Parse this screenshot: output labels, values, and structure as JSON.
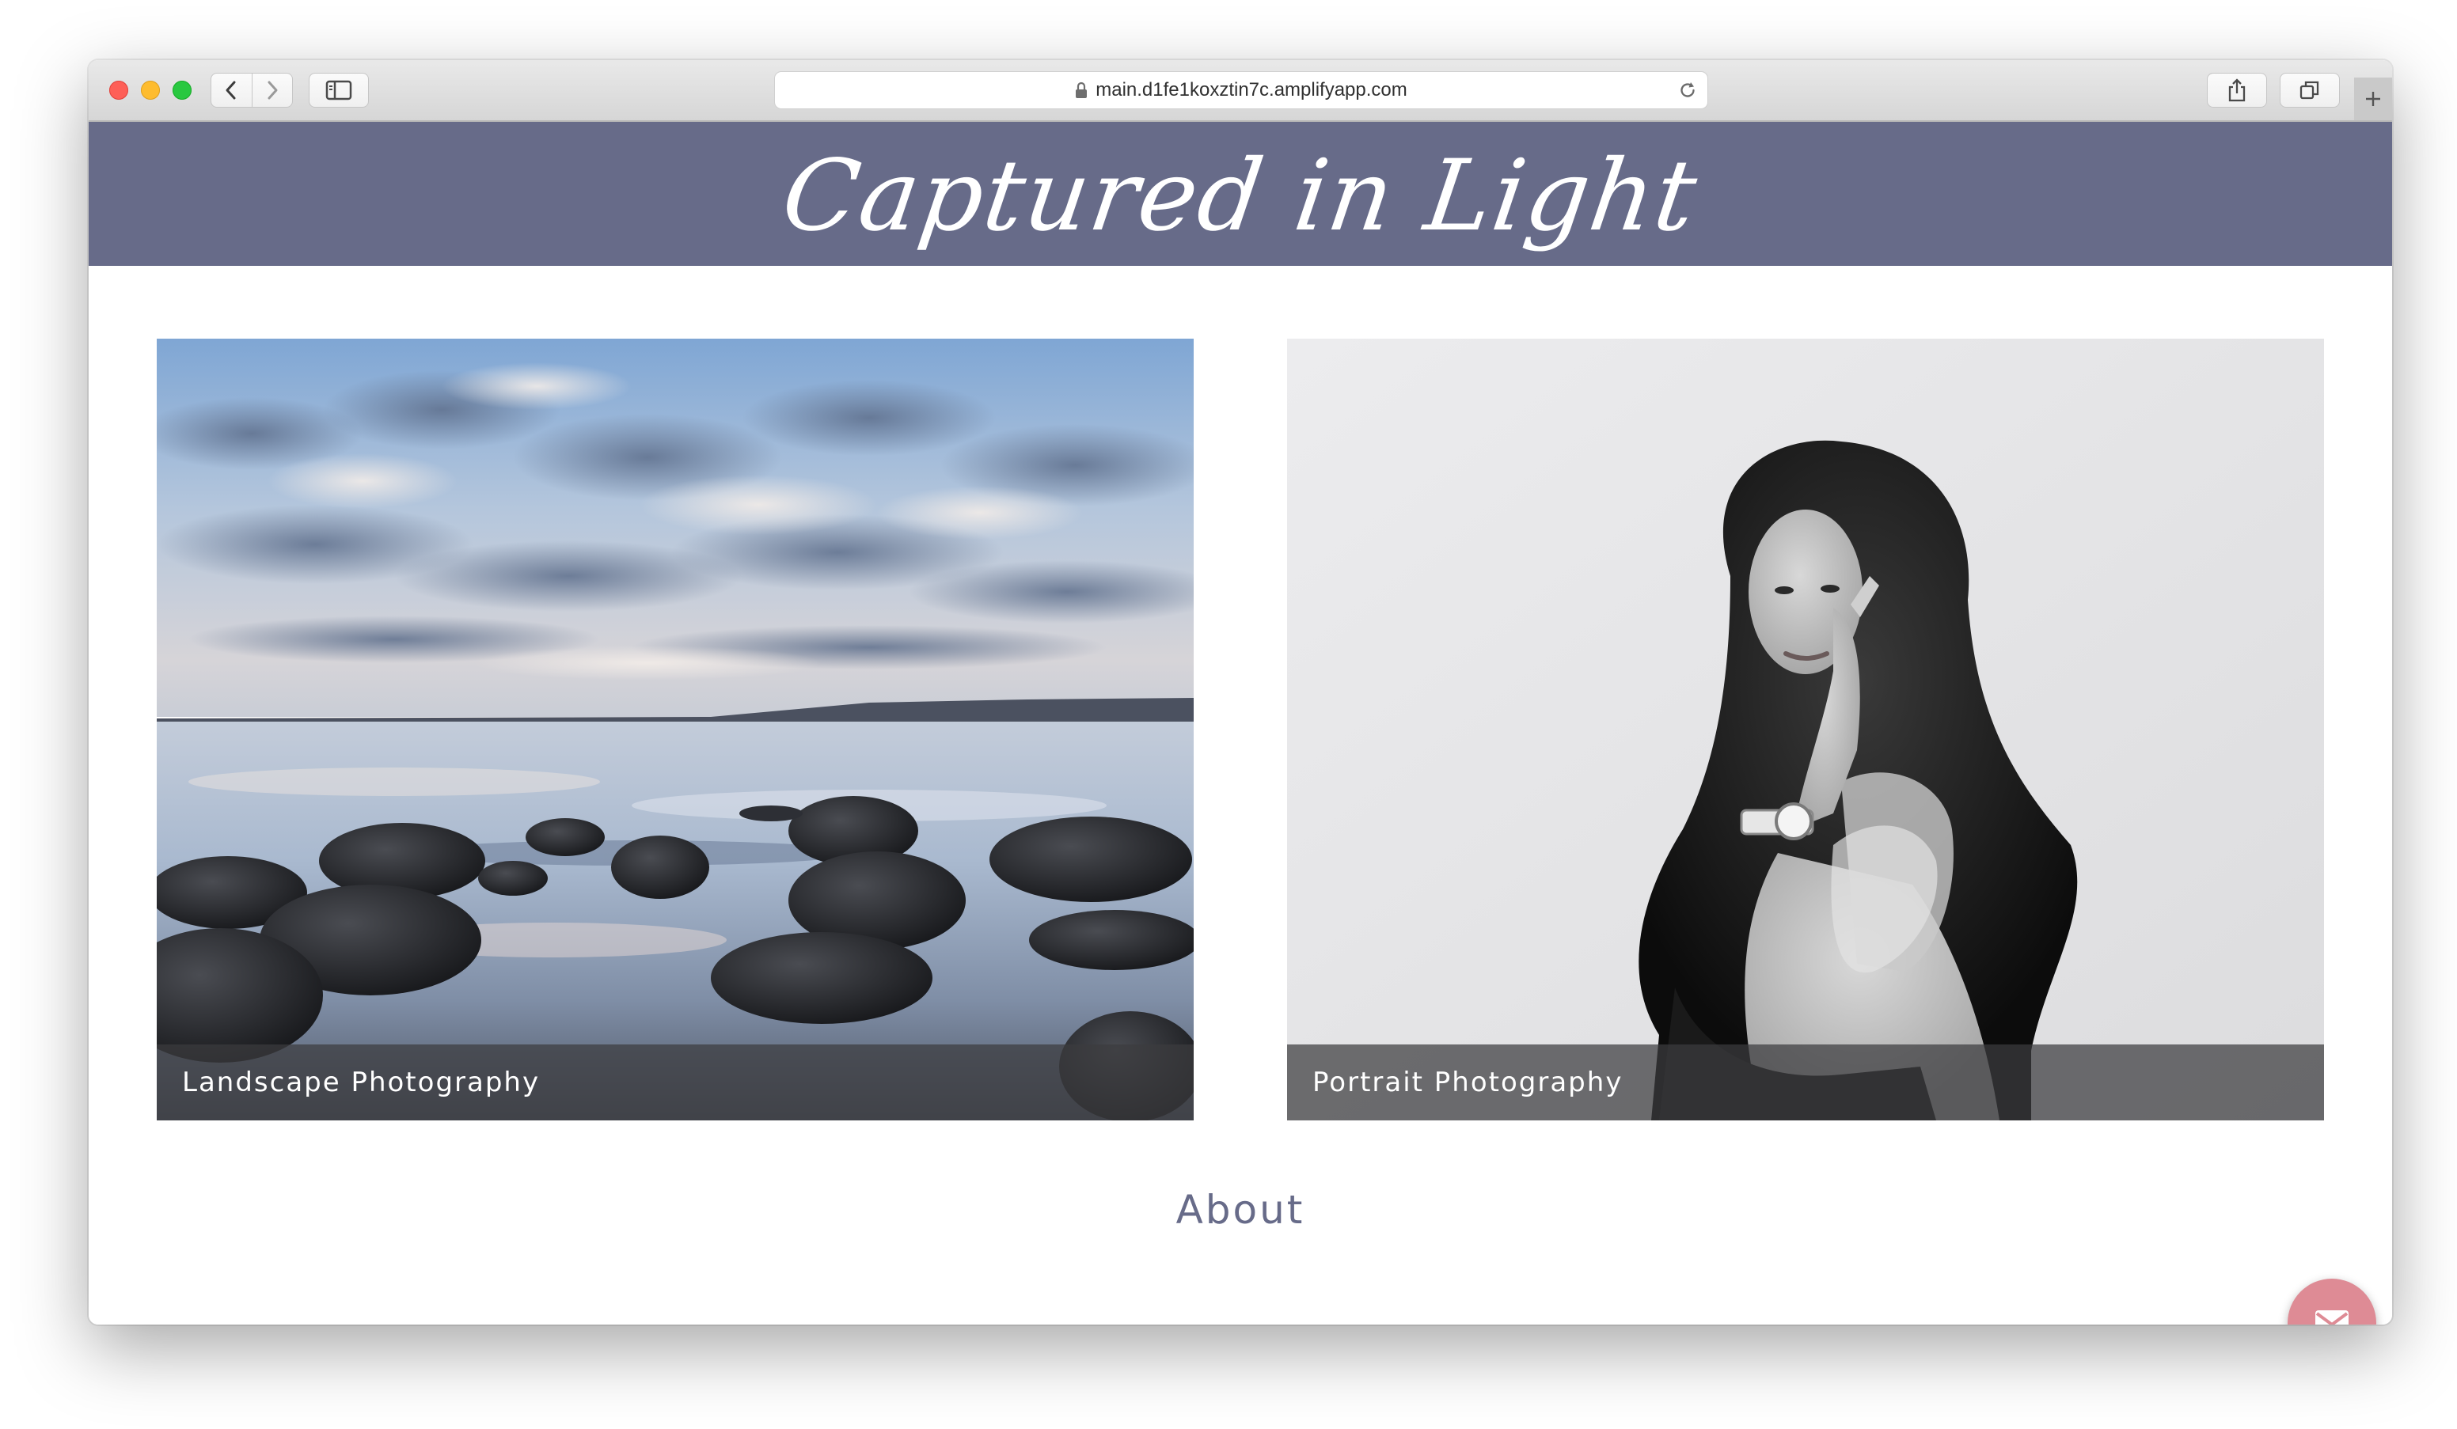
{
  "browser": {
    "url": "main.d1fe1koxztin7c.amplifyapp.com",
    "icons": {
      "back": "chevron-left-icon",
      "forward": "chevron-right-icon",
      "sidebar": "sidebar-icon",
      "lock": "lock-icon",
      "reload": "reload-icon",
      "share": "share-icon",
      "tabs": "tabs-overview-icon",
      "new_tab": "plus-icon"
    }
  },
  "site": {
    "title": "Captured in Light",
    "header_color": "#676b89",
    "accent_color": "#de8b95"
  },
  "gallery": [
    {
      "caption": "Landscape Photography"
    },
    {
      "caption": "Portrait Photography"
    }
  ],
  "about": {
    "heading": "About"
  },
  "contact": {
    "icon": "mail-icon"
  }
}
